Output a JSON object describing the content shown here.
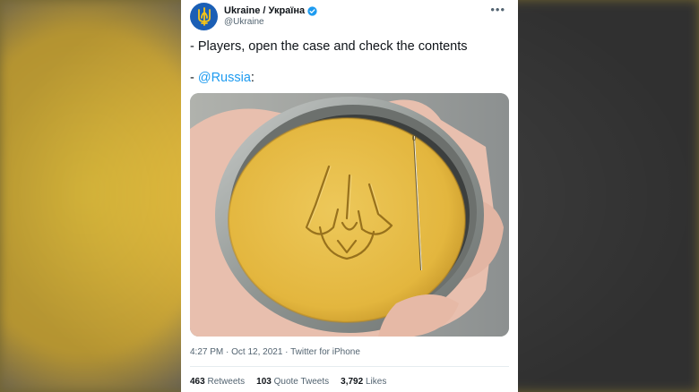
{
  "tweet": {
    "display_name": "Ukraine / Україна",
    "handle": "@Ukraine",
    "line1": "- Players, open the case and check the contents",
    "line2_prefix": "- ",
    "mention": "@Russia",
    "line2_suffix": ":",
    "timestamp": "4:27 PM · Oct 12, 2021 · Twitter for iPhone",
    "stats": {
      "retweets_count": "463",
      "retweets_label": "Retweets",
      "quotes_count": "103",
      "quotes_label": "Quote Tweets",
      "likes_count": "3,792",
      "likes_label": "Likes"
    }
  },
  "icons": {
    "avatar": "trident-icon",
    "verified": "verified-badge-icon",
    "more": "more-options-icon"
  },
  "colors": {
    "link": "#1d9bf0",
    "avatar_bg": "#1b5fb5",
    "trident": "#f5c518",
    "verified": "#1d9bf0",
    "candy": "#e3b63e"
  }
}
